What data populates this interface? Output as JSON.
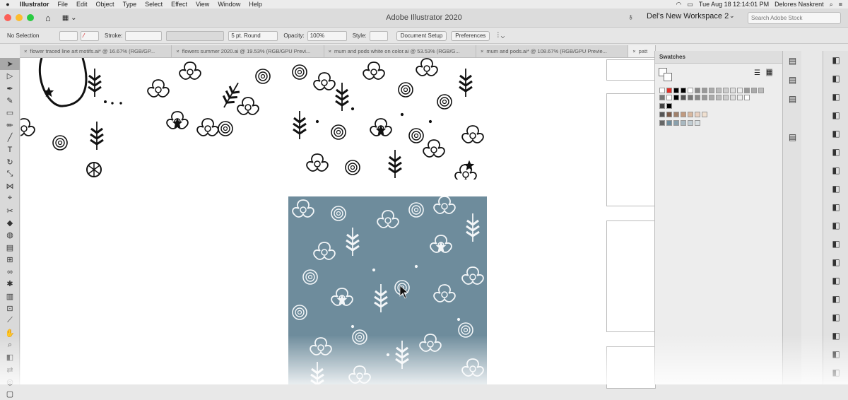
{
  "menubar": {
    "app": "Illustrator",
    "items": [
      "File",
      "Edit",
      "Object",
      "Type",
      "Select",
      "Effect",
      "View",
      "Window",
      "Help"
    ],
    "clock": "Tue Aug 18 12:14:01 PM",
    "user": "Delores Naskrent"
  },
  "titlebar": {
    "title": "Adobe Illustrator 2020",
    "workspace": "Del's New Workspace 2",
    "search_placeholder": "Search Adobe Stock"
  },
  "control": {
    "selection": "No Selection",
    "stroke_label": "Stroke:",
    "brush": "5 pt. Round",
    "opacity_label": "Opacity:",
    "opacity": "100%",
    "style_label": "Style:",
    "doc_setup": "Document Setup",
    "preferences": "Preferences"
  },
  "tabs": [
    {
      "label": "flower traced line art motifs.ai* @ 16.67% (RGB/GP..."
    },
    {
      "label": "flowers summer 2020.ai @ 19.53% (RGB/GPU Previ..."
    },
    {
      "label": "mum and pods white on color.ai @ 53.53% (RGB/G..."
    },
    {
      "label": "mum and pods.ai* @ 108.67% (RGB/GPU Previe..."
    },
    {
      "label": "patt"
    }
  ],
  "swatches": {
    "title": "Swatches"
  },
  "tools": [
    "selection-tool",
    "direct-selection-tool",
    "pen-tool",
    "curvature-tool",
    "rectangle-tool",
    "pencil-tool",
    "paintbrush-tool",
    "type-tool",
    "rotate-tool",
    "scale-tool",
    "width-tool",
    "eyedropper-tool",
    "knife-tool",
    "eraser-tool",
    "shape-builder-tool",
    "gradient-tool",
    "mesh-tool",
    "blend-tool",
    "symbol-sprayer-tool",
    "graph-tool",
    "artboard-tool",
    "slice-tool",
    "hand-tool",
    "zoom-tool",
    "fill-stroke",
    "swap-colors",
    "draw-mode",
    "screen-mode"
  ]
}
